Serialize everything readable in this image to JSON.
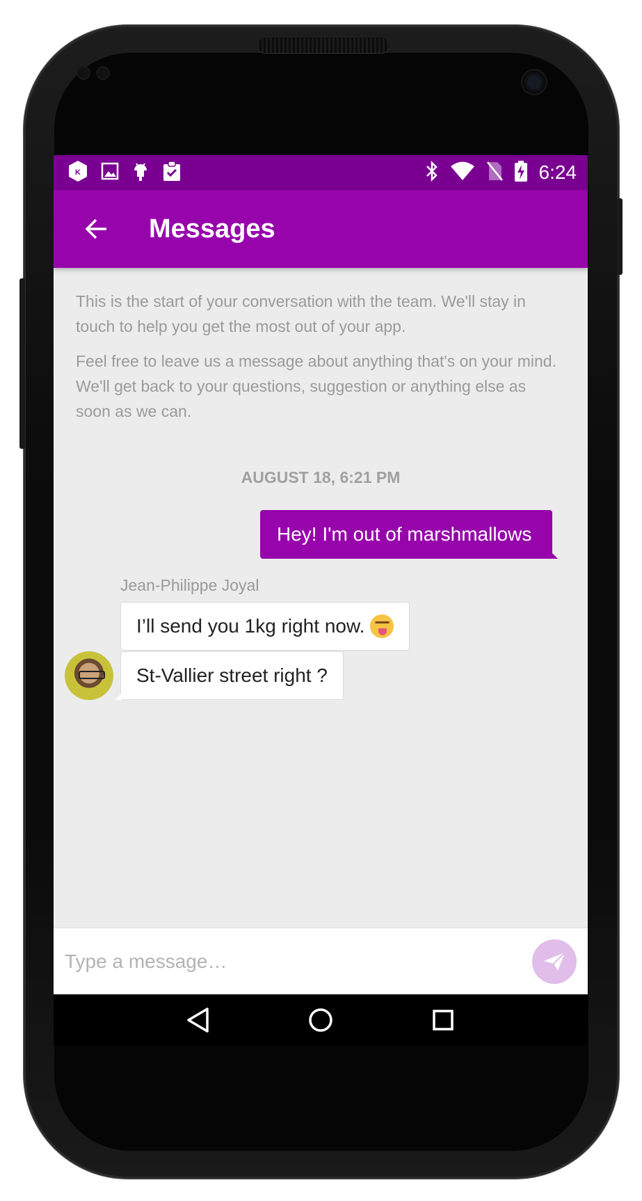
{
  "status_bar": {
    "time": "6:24",
    "left_icons": [
      "k-hexagon-icon",
      "image-icon",
      "android-icon",
      "clipboard-check-icon"
    ],
    "right_icons": [
      "bluetooth-icon",
      "wifi-icon",
      "no-sim-icon",
      "battery-charging-icon"
    ],
    "bar_color": "#7a0092"
  },
  "app_bar": {
    "title": "Messages",
    "color": "#9704ab"
  },
  "conversation": {
    "intro_paragraphs": [
      "This is the start of your conversation with the team. We'll stay in touch to help you get the most out of your app.",
      "Feel free to leave us a message about anything that's on your mind. We'll get back to your questions, suggestion or anything else as soon as we can."
    ],
    "date_divider": "AUGUST 18, 6:21 PM",
    "outgoing": [
      {
        "text": "Hey! I'm out of marshmallows"
      }
    ],
    "incoming_sender": "Jean-Philippe Joyal",
    "incoming": [
      {
        "text": "I’ll send you 1kg right now.",
        "emoji": "squinting-tongue-face"
      },
      {
        "text": "St-Vallier street right ?"
      }
    ]
  },
  "composer": {
    "placeholder": "Type a message…",
    "send_button_color": "#e1bde9"
  },
  "nav_bar": {
    "buttons": [
      "back-triangle-icon",
      "home-circle-icon",
      "recents-square-icon"
    ]
  }
}
